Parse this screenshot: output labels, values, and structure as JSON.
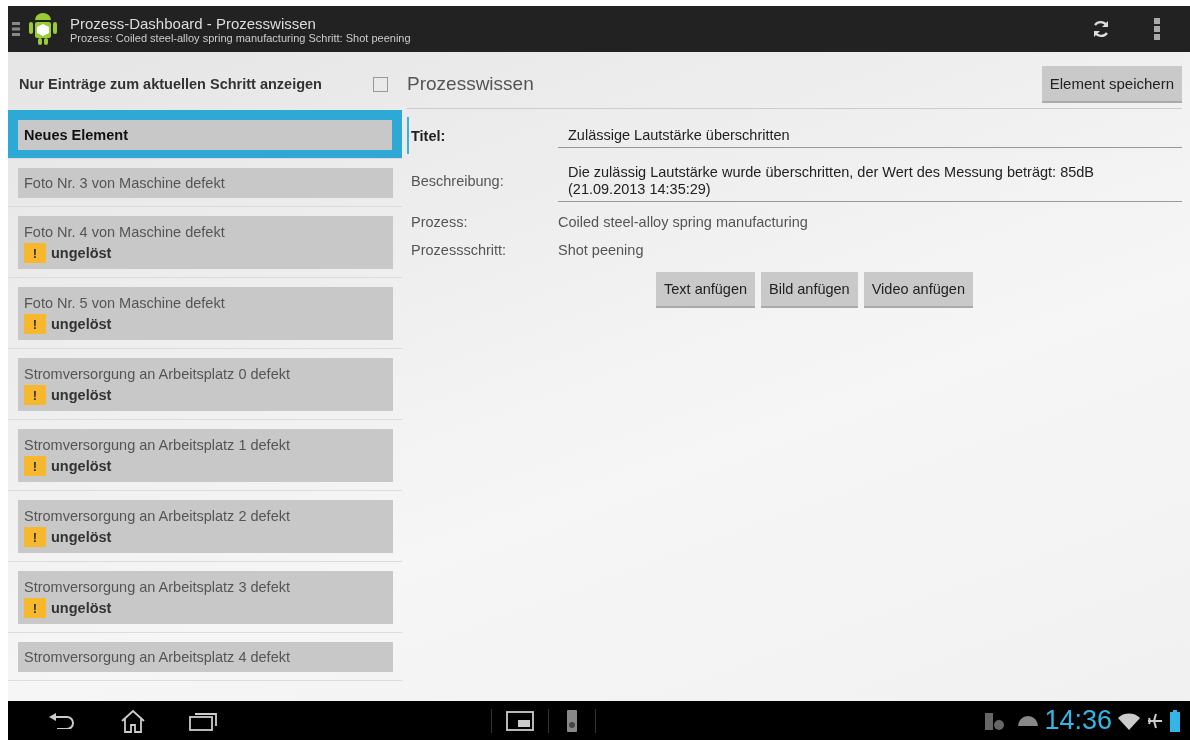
{
  "action_bar": {
    "title": "Prozess-Dashboard - Prozesswissen",
    "subtitle": "Prozess: Coiled steel-alloy spring manufacturing Schritt: Shot peening"
  },
  "filter": {
    "label": "Nur Einträge zum aktuellen Schritt anzeigen",
    "checked": false
  },
  "items": [
    {
      "title": "Neues Element",
      "selected": true
    },
    {
      "title": "Foto Nr. 3 von Maschine defekt",
      "selected": false
    },
    {
      "title": "Foto Nr. 4 von Maschine defekt",
      "status": "ungelöst",
      "badge": "!",
      "selected": false
    },
    {
      "title": "Foto Nr. 5 von Maschine defekt",
      "status": "ungelöst",
      "badge": "!",
      "selected": false
    },
    {
      "title": "Stromversorgung an Arbeitsplatz 0 defekt",
      "status": "ungelöst",
      "badge": "!",
      "selected": false
    },
    {
      "title": "Stromversorgung an Arbeitsplatz 1 defekt",
      "status": "ungelöst",
      "badge": "!",
      "selected": false
    },
    {
      "title": "Stromversorgung an Arbeitsplatz 2 defekt",
      "status": "ungelöst",
      "badge": "!",
      "selected": false
    },
    {
      "title": "Stromversorgung an Arbeitsplatz 3 defekt",
      "status": "ungelöst",
      "badge": "!",
      "selected": false
    },
    {
      "title": "Stromversorgung an Arbeitsplatz 4 defekt",
      "selected": false
    }
  ],
  "detail": {
    "heading": "Prozesswissen",
    "save_button": "Element speichern",
    "fields": [
      {
        "kind": "input",
        "label": "Titel:",
        "value": "Zulässige Lautstärke überschritten",
        "focused": true
      },
      {
        "kind": "input",
        "label": "Beschreibung:",
        "value": "Die zulässig Lautstärke wurde überschritten, der Wert des Messung beträgt: 85dB (21.09.2013 14:35:29)",
        "focused": false
      },
      {
        "kind": "text",
        "label": "Prozess:",
        "value": "Coiled steel-alloy spring manufacturing"
      },
      {
        "kind": "text",
        "label": "Prozessschritt:",
        "value": "Shot peening"
      }
    ],
    "buttons": [
      "Text anfügen",
      "Bild anfügen",
      "Video anfügen"
    ]
  },
  "status_bar": {
    "time": "14:36"
  }
}
